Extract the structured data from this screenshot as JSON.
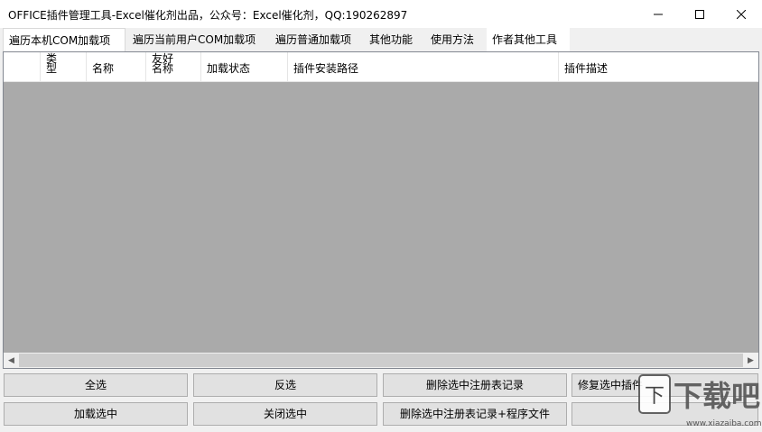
{
  "window": {
    "title": "OFFICE插件管理工具-Excel催化剂出品，公众号：Excel催化剂，QQ:190262897"
  },
  "tabs": [
    {
      "label": "遍历本机COM加载项"
    },
    {
      "label": "遍历当前用户COM加载项"
    },
    {
      "label": "遍历普通加载项"
    },
    {
      "label": "其他功能"
    },
    {
      "label": "使用方法"
    },
    {
      "label": "作者其他工具"
    }
  ],
  "table": {
    "columns": [
      {
        "label": ""
      },
      {
        "label": "类型"
      },
      {
        "label": "名称"
      },
      {
        "label": "友好名称"
      },
      {
        "label": "加载状态"
      },
      {
        "label": "插件安装路径"
      },
      {
        "label": "插件描述"
      }
    ]
  },
  "buttons": {
    "select_all": "全选",
    "invert": "反选",
    "delete_registry": "删除选中注册表记录",
    "repair": "修复选中插件",
    "load_selected": "加载选中",
    "close_selected": "关闭选中",
    "delete_registry_files": "删除选中注册表记录+程序文件"
  },
  "watermark": {
    "text": "下载吧",
    "url": "www.xiazaiba.com"
  },
  "colors": {
    "grid_bg": "#aaaaaa",
    "window_bg": "#f0f0f0",
    "button_bg": "#e1e1e1"
  }
}
